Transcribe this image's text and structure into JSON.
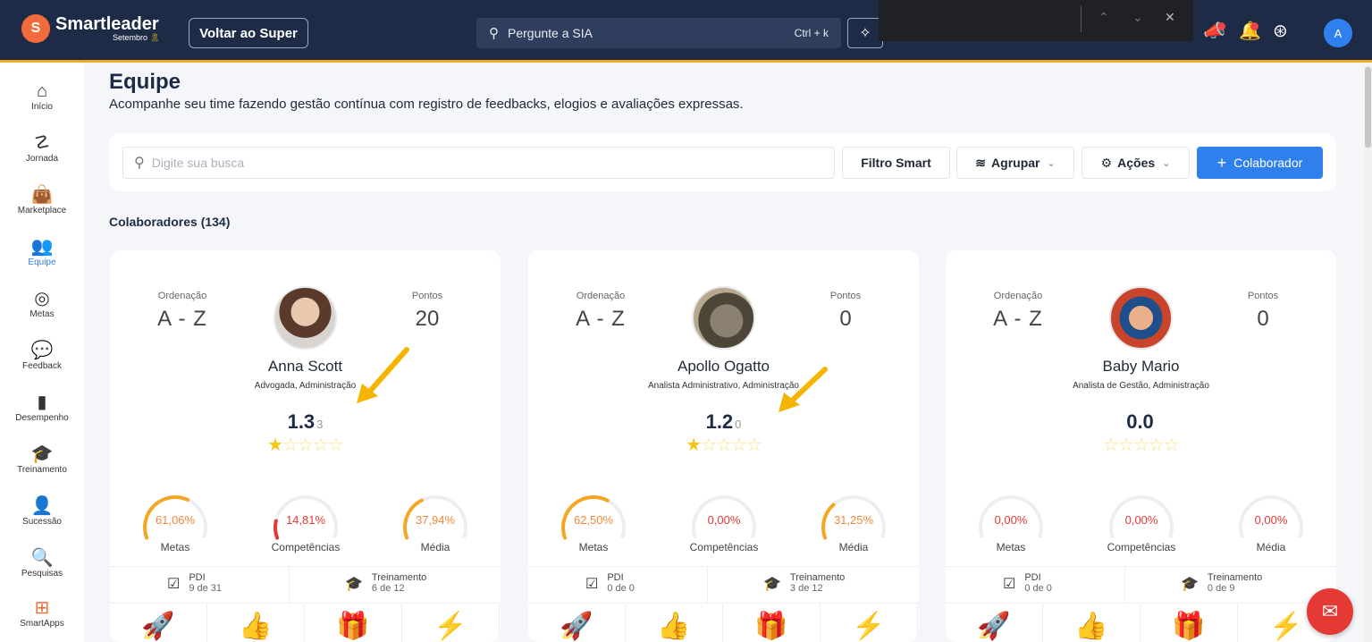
{
  "topbar": {
    "logo_mark": "S",
    "brand": "Smartleader",
    "brand_sub": "Setembro",
    "brand_ribbon": "🎗",
    "back_button": "Voltar ao Super",
    "sia_placeholder": "Pergunte a SIA",
    "sia_shortcut": "Ctrl + k",
    "find_controls": [
      "⌃",
      "⌄",
      "✕"
    ],
    "avatar_initial": "A"
  },
  "sidebar": {
    "items": [
      {
        "icon": "home-icon",
        "glyph": "⌂",
        "label": "Início"
      },
      {
        "icon": "journey-icon",
        "glyph": "☡",
        "label": "Jornada"
      },
      {
        "icon": "bag-icon",
        "glyph": "👜",
        "label": "Marketplace"
      },
      {
        "icon": "team-icon",
        "glyph": "👥",
        "label": "Equipe"
      },
      {
        "icon": "target-icon",
        "glyph": "◎",
        "label": "Metas"
      },
      {
        "icon": "chat-bubbles-icon",
        "glyph": "💬",
        "label": "Feedback"
      },
      {
        "icon": "bar-chart-icon",
        "glyph": "▮",
        "label": "Desempenho"
      },
      {
        "icon": "graduation-cap-icon",
        "glyph": "🎓",
        "label": "Treinamento"
      },
      {
        "icon": "user-plus-icon",
        "glyph": "👤",
        "label": "Sucessão"
      },
      {
        "icon": "survey-icon",
        "glyph": "🔍",
        "label": "Pesquisas"
      },
      {
        "icon": "apps-icon",
        "glyph": "⊞",
        "label": "SmartApps"
      }
    ],
    "active_index": 3
  },
  "page": {
    "title": "Equipe",
    "subtitle": "Acompanhe seu time fazendo gestão contínua com registro de feedbacks, elogios e avaliações expressas.",
    "search_placeholder": "Digite sua busca",
    "filter_button": "Filtro Smart",
    "group_button": "Agrupar",
    "actions_button": "Ações",
    "add_button": "Colaborador",
    "count_title": "Colaboradores (134)"
  },
  "colors": {
    "accent": "#2f80ed",
    "topbar": "#1d2b46",
    "gauge_orange": "#f5a623",
    "gauge_red": "#e53935",
    "star": "#f5c518"
  },
  "cards": [
    {
      "order_label": "Ordenação",
      "order_value": "A - Z",
      "points_label": "Pontos",
      "points_value": "20",
      "name": "Anna Scott",
      "role": "Advogada, Administração",
      "score": "1.3",
      "score_count": "3",
      "stars_filled": 1,
      "gauges": [
        {
          "value": "61,06%",
          "fraction": 0.6106,
          "label": "Metas",
          "color": "orange"
        },
        {
          "value": "14,81%",
          "fraction": 0.1481,
          "label": "Competências",
          "color": "red"
        },
        {
          "value": "37,94%",
          "fraction": 0.3794,
          "label": "Média",
          "color": "orange"
        }
      ],
      "pdi_label": "PDI",
      "pdi_value": "9 de 31",
      "training_label": "Treinamento",
      "training_value": "6 de 12"
    },
    {
      "order_label": "Ordenação",
      "order_value": "A - Z",
      "points_label": "Pontos",
      "points_value": "0",
      "name": "Apollo Ogatto",
      "role": "Analista Administrativo, Administração",
      "score": "1.2",
      "score_count": "0",
      "stars_filled": 1,
      "gauges": [
        {
          "value": "62,50%",
          "fraction": 0.625,
          "label": "Metas",
          "color": "orange"
        },
        {
          "value": "0,00%",
          "fraction": 0,
          "label": "Competências",
          "color": "red"
        },
        {
          "value": "31,25%",
          "fraction": 0.3125,
          "label": "Média",
          "color": "orange"
        }
      ],
      "pdi_label": "PDI",
      "pdi_value": "0 de 0",
      "training_label": "Treinamento",
      "training_value": "3 de 12"
    },
    {
      "order_label": "Ordenação",
      "order_value": "A - Z",
      "points_label": "Pontos",
      "points_value": "0",
      "name": "Baby Mario",
      "role": "Analista de Gestão, Administração",
      "score": "0.0",
      "score_count": "",
      "stars_filled": 0,
      "gauges": [
        {
          "value": "0,00%",
          "fraction": 0,
          "label": "Metas",
          "color": "red"
        },
        {
          "value": "0,00%",
          "fraction": 0,
          "label": "Competências",
          "color": "red"
        },
        {
          "value": "0,00%",
          "fraction": 0,
          "label": "Média",
          "color": "red"
        }
      ],
      "pdi_label": "PDI",
      "pdi_value": "0 de 0",
      "training_label": "Treinamento",
      "training_value": "0 de 9"
    }
  ],
  "card_actions": [
    {
      "icon": "rocket-icon",
      "glyph": "🚀",
      "color": "#e53935"
    },
    {
      "icon": "thumbs-up-icon",
      "glyph": "👍",
      "color": "#22a745"
    },
    {
      "icon": "gift-icon",
      "glyph": "🎁",
      "color": "#2f80ed"
    },
    {
      "icon": "lightning-icon",
      "glyph": "⚡",
      "color": "#f5c518"
    }
  ]
}
